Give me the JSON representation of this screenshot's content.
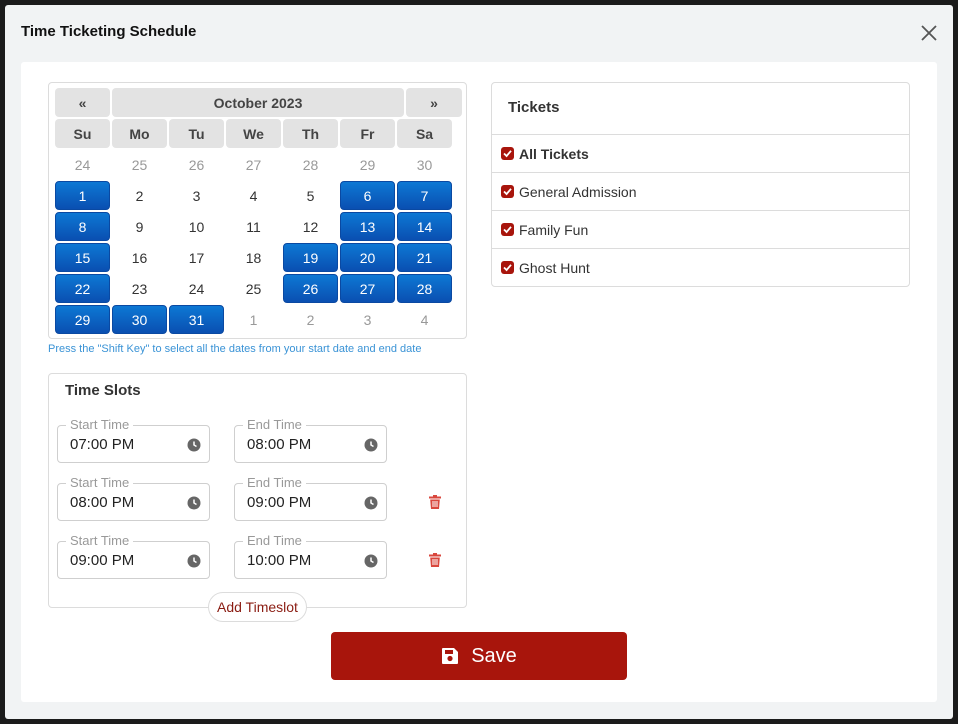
{
  "modal": {
    "title": "Time Ticketing Schedule"
  },
  "calendar": {
    "prev": "«",
    "next": "»",
    "month": "October 2023",
    "weekdays": [
      "Su",
      "Mo",
      "Tu",
      "We",
      "Th",
      "Fr",
      "Sa"
    ],
    "days": [
      {
        "d": "24",
        "other": true,
        "sel": false
      },
      {
        "d": "25",
        "other": true,
        "sel": false
      },
      {
        "d": "26",
        "other": true,
        "sel": false
      },
      {
        "d": "27",
        "other": true,
        "sel": false
      },
      {
        "d": "28",
        "other": true,
        "sel": false
      },
      {
        "d": "29",
        "other": true,
        "sel": false
      },
      {
        "d": "30",
        "other": true,
        "sel": false
      },
      {
        "d": "1",
        "other": false,
        "sel": true
      },
      {
        "d": "2",
        "other": false,
        "sel": false
      },
      {
        "d": "3",
        "other": false,
        "sel": false
      },
      {
        "d": "4",
        "other": false,
        "sel": false
      },
      {
        "d": "5",
        "other": false,
        "sel": false
      },
      {
        "d": "6",
        "other": false,
        "sel": true
      },
      {
        "d": "7",
        "other": false,
        "sel": true
      },
      {
        "d": "8",
        "other": false,
        "sel": true
      },
      {
        "d": "9",
        "other": false,
        "sel": false
      },
      {
        "d": "10",
        "other": false,
        "sel": false
      },
      {
        "d": "11",
        "other": false,
        "sel": false
      },
      {
        "d": "12",
        "other": false,
        "sel": false
      },
      {
        "d": "13",
        "other": false,
        "sel": true
      },
      {
        "d": "14",
        "other": false,
        "sel": true
      },
      {
        "d": "15",
        "other": false,
        "sel": true
      },
      {
        "d": "16",
        "other": false,
        "sel": false
      },
      {
        "d": "17",
        "other": false,
        "sel": false
      },
      {
        "d": "18",
        "other": false,
        "sel": false
      },
      {
        "d": "19",
        "other": false,
        "sel": true
      },
      {
        "d": "20",
        "other": false,
        "sel": true
      },
      {
        "d": "21",
        "other": false,
        "sel": true
      },
      {
        "d": "22",
        "other": false,
        "sel": true
      },
      {
        "d": "23",
        "other": false,
        "sel": false
      },
      {
        "d": "24",
        "other": false,
        "sel": false
      },
      {
        "d": "25",
        "other": false,
        "sel": false
      },
      {
        "d": "26",
        "other": false,
        "sel": true
      },
      {
        "d": "27",
        "other": false,
        "sel": true
      },
      {
        "d": "28",
        "other": false,
        "sel": true
      },
      {
        "d": "29",
        "other": false,
        "sel": true
      },
      {
        "d": "30",
        "other": false,
        "sel": true
      },
      {
        "d": "31",
        "other": false,
        "sel": true
      },
      {
        "d": "1",
        "other": true,
        "sel": false
      },
      {
        "d": "2",
        "other": true,
        "sel": false
      },
      {
        "d": "3",
        "other": true,
        "sel": false
      },
      {
        "d": "4",
        "other": true,
        "sel": false
      }
    ],
    "hint": "Press the \"Shift Key\" to select all the dates from your start date and end date"
  },
  "time_slots": {
    "title": "Time Slots",
    "start_label": "Start Time",
    "end_label": "End Time",
    "rows": [
      {
        "start": "07:00 PM",
        "end": "08:00 PM",
        "deletable": false
      },
      {
        "start": "08:00 PM",
        "end": "09:00 PM",
        "deletable": true
      },
      {
        "start": "09:00 PM",
        "end": "10:00 PM",
        "deletable": true
      }
    ],
    "add_label": "Add Timeslot"
  },
  "tickets": {
    "title": "Tickets",
    "items": [
      {
        "label": "All Tickets",
        "checked": true,
        "bold": true
      },
      {
        "label": "General Admission",
        "checked": true,
        "bold": false
      },
      {
        "label": "Family Fun",
        "checked": true,
        "bold": false
      },
      {
        "label": "Ghost Hunt",
        "checked": true,
        "bold": false
      }
    ]
  },
  "save": {
    "label": "Save"
  },
  "colors": {
    "primary": "#a8150c",
    "selected_day": "#0a5fc4",
    "hint": "#3a93d6"
  },
  "icons": {
    "close": "close-icon",
    "clock": "clock-icon",
    "trash": "trash-icon",
    "save": "floppy-disk-icon",
    "check": "check-icon"
  }
}
